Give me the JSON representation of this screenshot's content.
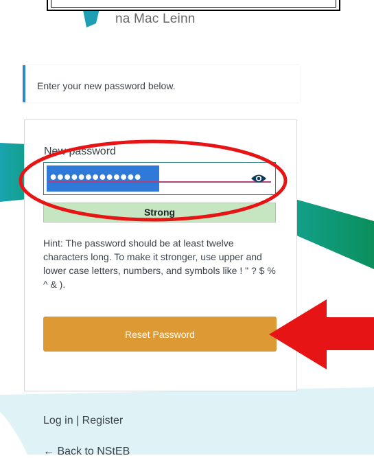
{
  "header": {
    "subtitle": "na Mac Leinn"
  },
  "message": {
    "text": "Enter your new password below."
  },
  "form": {
    "password_label": "New password",
    "password_value": "•••••••••••••",
    "strength_label": "Strong",
    "hint": "Hint: The password should be at least twelve characters long. To make it stronger, use upper and lower case letters, numbers, and symbols like ! \" ? $ % ^ & ).",
    "reset_button_label": "Reset Password"
  },
  "nav": {
    "login_label": "Log in",
    "separator": "|",
    "register_label": "Register",
    "back_label": "← Back to NStEB"
  },
  "colors": {
    "accent_teal": "#1aa3b0",
    "accent_green": "#0e9a6e",
    "message_border": "#2f86c9",
    "button": "#dd9933",
    "strength_bg": "#c5e6c0",
    "annotation_red": "#e61414"
  },
  "icons": {
    "show_password": "eye-icon"
  }
}
